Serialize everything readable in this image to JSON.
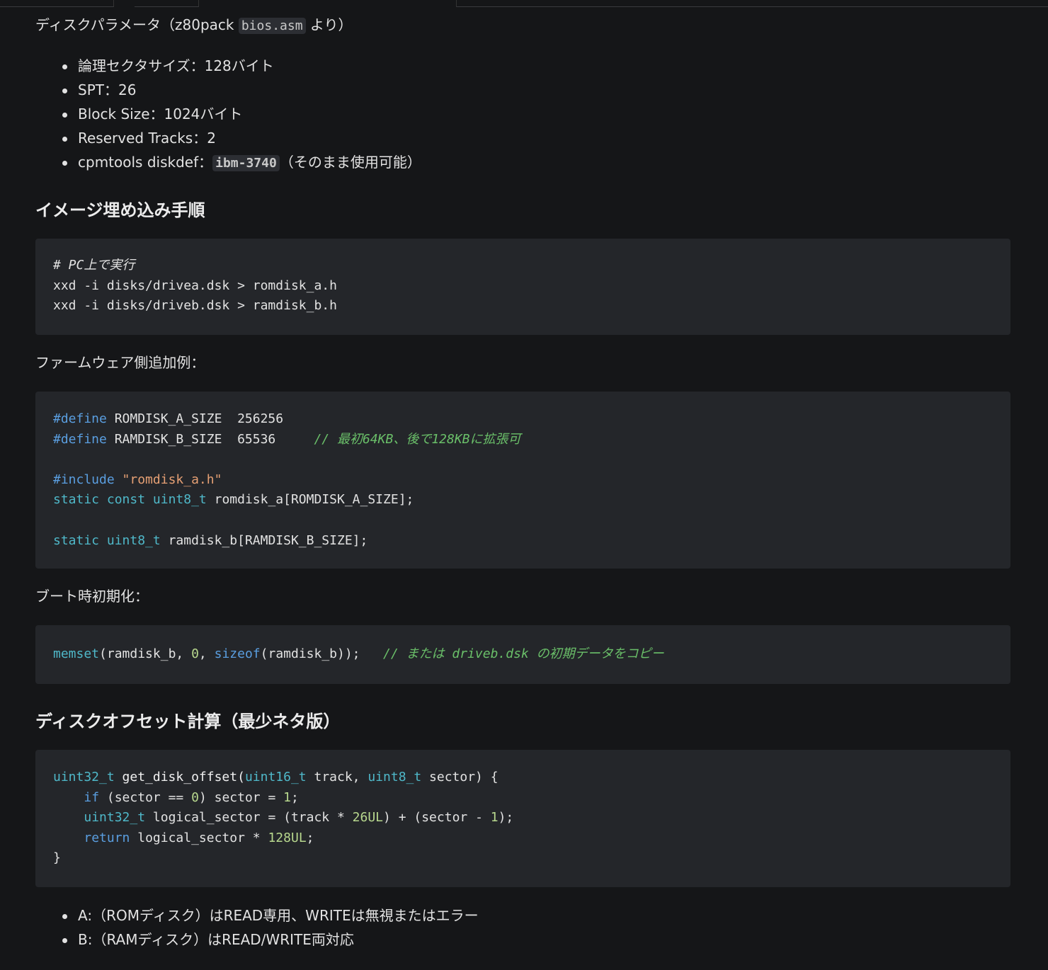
{
  "disk_params": {
    "heading_prefix": "ディスクパラメータ（z80pack ",
    "heading_code": "bios.asm",
    "heading_suffix": " より）",
    "items": [
      "論理セクタサイズ：128バイト",
      "SPT：26",
      "Block Size：1024バイト",
      "Reserved Tracks：2"
    ],
    "diskdef_prefix": "cpmtools diskdef：",
    "diskdef_code": "ibm-3740",
    "diskdef_suffix": "（そのまま使用可能）"
  },
  "embed_section": {
    "title": "イメージ埋め込み手順",
    "code1": {
      "comment": "# PC上で実行",
      "line1": "xxd -i disks/drivea.dsk > romdisk_a.h",
      "line2": "xxd -i disks/driveb.dsk > ramdisk_b.h"
    },
    "firmware_label": "ファームウェア側追加例：",
    "code2": {
      "define_kw": "#define",
      "define1_rest": " ROMDISK_A_SIZE  256256",
      "define2_rest": " RAMDISK_B_SIZE  65536     ",
      "define2_comment": "// 最初64KB、後で128KBに拡張可",
      "include_kw": "#include",
      "include_str": "\"romdisk_a.h\"",
      "static_kw": "static",
      "const_kw": "const",
      "uint8_kw": "uint8_t",
      "romdisk_rest": " romdisk_a[ROMDISK_A_SIZE];",
      "ramdisk_rest": " ramdisk_b[RAMDISK_B_SIZE];"
    },
    "boot_label": "ブート時初期化：",
    "code3": {
      "memset": "memset",
      "open": "(ramdisk_b, ",
      "zero": "0",
      "comma": ", ",
      "sizeof": "sizeof",
      "close": "(ramdisk_b));   ",
      "comment": "// または driveb.dsk の初期データをコピー"
    }
  },
  "offset_section": {
    "title": "ディスクオフセット計算（最少ネタ版）",
    "code4": {
      "uint32": "uint32_t",
      "fn_name": " get_disk_offset(",
      "uint16": "uint16_t",
      "track_param": " track, ",
      "uint8": "uint8_t",
      "sector_param": " sector) {",
      "if_kw": "if",
      "if_cond": " (sector == ",
      "zero": "0",
      "if_rest": ") sector = ",
      "one": "1",
      "semi": ";",
      "logical_decl": " logical_sector = (track * ",
      "spt": "26UL",
      "logical_mid": ") + (sector - ",
      "logical_end": ");",
      "return_kw": "return",
      "return_rest": " logical_sector * ",
      "sector_size": "128UL",
      "closing": "}"
    },
    "notes": [
      "A:（ROMディスク）はREAD専用、WRITEは無視またはエラー",
      "B:（RAMディスク）はREAD/WRITE両対応"
    ]
  }
}
